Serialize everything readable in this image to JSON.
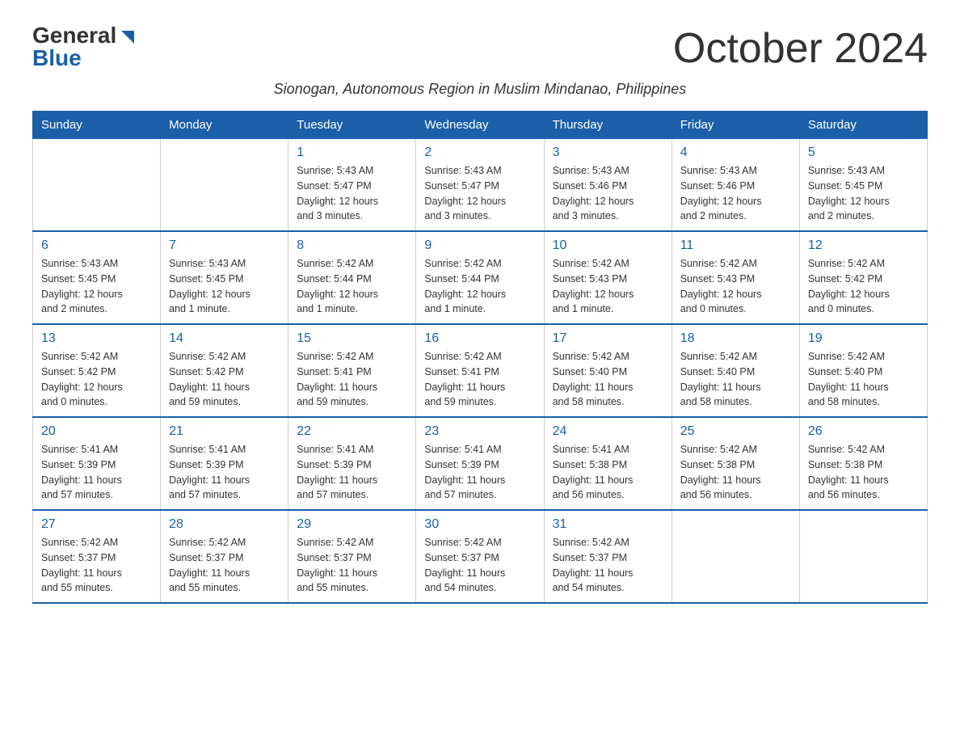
{
  "header": {
    "logo_general": "General",
    "logo_blue": "Blue",
    "month_title": "October 2024",
    "subtitle": "Sionogan, Autonomous Region in Muslim Mindanao, Philippines"
  },
  "calendar": {
    "days_of_week": [
      "Sunday",
      "Monday",
      "Tuesday",
      "Wednesday",
      "Thursday",
      "Friday",
      "Saturday"
    ],
    "weeks": [
      [
        {
          "day": "",
          "info": ""
        },
        {
          "day": "",
          "info": ""
        },
        {
          "day": "1",
          "info": "Sunrise: 5:43 AM\nSunset: 5:47 PM\nDaylight: 12 hours\nand 3 minutes."
        },
        {
          "day": "2",
          "info": "Sunrise: 5:43 AM\nSunset: 5:47 PM\nDaylight: 12 hours\nand 3 minutes."
        },
        {
          "day": "3",
          "info": "Sunrise: 5:43 AM\nSunset: 5:46 PM\nDaylight: 12 hours\nand 3 minutes."
        },
        {
          "day": "4",
          "info": "Sunrise: 5:43 AM\nSunset: 5:46 PM\nDaylight: 12 hours\nand 2 minutes."
        },
        {
          "day": "5",
          "info": "Sunrise: 5:43 AM\nSunset: 5:45 PM\nDaylight: 12 hours\nand 2 minutes."
        }
      ],
      [
        {
          "day": "6",
          "info": "Sunrise: 5:43 AM\nSunset: 5:45 PM\nDaylight: 12 hours\nand 2 minutes."
        },
        {
          "day": "7",
          "info": "Sunrise: 5:43 AM\nSunset: 5:45 PM\nDaylight: 12 hours\nand 1 minute."
        },
        {
          "day": "8",
          "info": "Sunrise: 5:42 AM\nSunset: 5:44 PM\nDaylight: 12 hours\nand 1 minute."
        },
        {
          "day": "9",
          "info": "Sunrise: 5:42 AM\nSunset: 5:44 PM\nDaylight: 12 hours\nand 1 minute."
        },
        {
          "day": "10",
          "info": "Sunrise: 5:42 AM\nSunset: 5:43 PM\nDaylight: 12 hours\nand 1 minute."
        },
        {
          "day": "11",
          "info": "Sunrise: 5:42 AM\nSunset: 5:43 PM\nDaylight: 12 hours\nand 0 minutes."
        },
        {
          "day": "12",
          "info": "Sunrise: 5:42 AM\nSunset: 5:42 PM\nDaylight: 12 hours\nand 0 minutes."
        }
      ],
      [
        {
          "day": "13",
          "info": "Sunrise: 5:42 AM\nSunset: 5:42 PM\nDaylight: 12 hours\nand 0 minutes."
        },
        {
          "day": "14",
          "info": "Sunrise: 5:42 AM\nSunset: 5:42 PM\nDaylight: 11 hours\nand 59 minutes."
        },
        {
          "day": "15",
          "info": "Sunrise: 5:42 AM\nSunset: 5:41 PM\nDaylight: 11 hours\nand 59 minutes."
        },
        {
          "day": "16",
          "info": "Sunrise: 5:42 AM\nSunset: 5:41 PM\nDaylight: 11 hours\nand 59 minutes."
        },
        {
          "day": "17",
          "info": "Sunrise: 5:42 AM\nSunset: 5:40 PM\nDaylight: 11 hours\nand 58 minutes."
        },
        {
          "day": "18",
          "info": "Sunrise: 5:42 AM\nSunset: 5:40 PM\nDaylight: 11 hours\nand 58 minutes."
        },
        {
          "day": "19",
          "info": "Sunrise: 5:42 AM\nSunset: 5:40 PM\nDaylight: 11 hours\nand 58 minutes."
        }
      ],
      [
        {
          "day": "20",
          "info": "Sunrise: 5:41 AM\nSunset: 5:39 PM\nDaylight: 11 hours\nand 57 minutes."
        },
        {
          "day": "21",
          "info": "Sunrise: 5:41 AM\nSunset: 5:39 PM\nDaylight: 11 hours\nand 57 minutes."
        },
        {
          "day": "22",
          "info": "Sunrise: 5:41 AM\nSunset: 5:39 PM\nDaylight: 11 hours\nand 57 minutes."
        },
        {
          "day": "23",
          "info": "Sunrise: 5:41 AM\nSunset: 5:39 PM\nDaylight: 11 hours\nand 57 minutes."
        },
        {
          "day": "24",
          "info": "Sunrise: 5:41 AM\nSunset: 5:38 PM\nDaylight: 11 hours\nand 56 minutes."
        },
        {
          "day": "25",
          "info": "Sunrise: 5:42 AM\nSunset: 5:38 PM\nDaylight: 11 hours\nand 56 minutes."
        },
        {
          "day": "26",
          "info": "Sunrise: 5:42 AM\nSunset: 5:38 PM\nDaylight: 11 hours\nand 56 minutes."
        }
      ],
      [
        {
          "day": "27",
          "info": "Sunrise: 5:42 AM\nSunset: 5:37 PM\nDaylight: 11 hours\nand 55 minutes."
        },
        {
          "day": "28",
          "info": "Sunrise: 5:42 AM\nSunset: 5:37 PM\nDaylight: 11 hours\nand 55 minutes."
        },
        {
          "day": "29",
          "info": "Sunrise: 5:42 AM\nSunset: 5:37 PM\nDaylight: 11 hours\nand 55 minutes."
        },
        {
          "day": "30",
          "info": "Sunrise: 5:42 AM\nSunset: 5:37 PM\nDaylight: 11 hours\nand 54 minutes."
        },
        {
          "day": "31",
          "info": "Sunrise: 5:42 AM\nSunset: 5:37 PM\nDaylight: 11 hours\nand 54 minutes."
        },
        {
          "day": "",
          "info": ""
        },
        {
          "day": "",
          "info": ""
        }
      ]
    ]
  }
}
